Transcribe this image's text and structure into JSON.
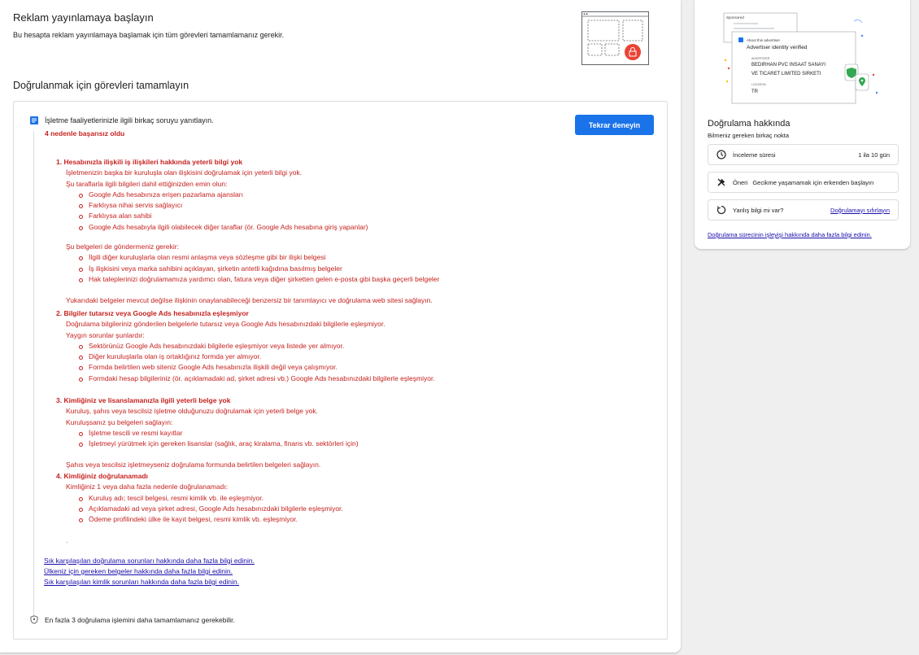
{
  "header": {
    "title": "Reklam yayınlamaya başlayın",
    "subtitle": "Bu hesapta reklam yayınlamaya başlamak için tüm görevleri tamamlamanız gerekir."
  },
  "tasks": {
    "section_title": "Doğrulanmak için görevleri tamamlayın",
    "question": "İşletme faaliyetlerinizle ilgili birkaç soruyu yanıtlayın.",
    "fail_text": "4 nedenle başarısız oldu",
    "retry_label": "Tekrar deneyin",
    "reasons": [
      {
        "title": "1. Hesabınızla ilişkili iş ilişkileri hakkında yeterli bilgi yok",
        "lines": [
          "İşletmenizin başka bir kuruluşla olan ilişkisini doğrulamak için yeterli bilgi yok.",
          "Şu taraflarla ilgili bilgileri dahil ettiğinizden emin olun:"
        ],
        "bullets": [
          "Google Ads hesabınıza erişen pazarlama ajansları",
          "Farklıysa nihai servis sağlayıcı",
          "Farklıysa alan sahibi",
          "Google Ads hesabıyla ilgili olabilecek diğer taraflar (ör. Google Ads hesabına giriş yapanlar)"
        ],
        "lines2": [
          "Şu belgeleri de göndermeniz gerekir:"
        ],
        "bullets2": [
          "İlgili diğer kuruluşlarla olan resmi anlaşma veya sözleşme gibi bir ilişki belgesi",
          "İş ilişkisini veya marka sahibini açıklayan, şirketin antetli kağıdına basılmış belgeler",
          "Hak taleplerinizi doğrulamamıza yardımcı olan, fatura veya diğer şirketten gelen e-posta gibi başka geçerli belgeler"
        ],
        "closing": "Yukarıdaki belgeler mevcut değilse ilişkinin onaylanabileceği benzersiz bir tanımlayıcı ve doğrulama web sitesi sağlayın."
      },
      {
        "title": "2. Bilgiler tutarsız veya Google Ads hesabınızla eşleşmiyor",
        "lines": [
          "Doğrulama bilgileriniz gönderilen belgelerle tutarsız veya Google Ads hesabınızdaki bilgilerle eşleşmiyor.",
          "Yaygın sorunlar şunlardır:"
        ],
        "bullets": [
          "Sektörünüz Google Ads hesabınızdaki bilgilerle eşleşmiyor veya listede yer almıyor.",
          "Diğer kuruluşlarla olan iş ortaklığınız formda yer almıyor.",
          "Formda belirtilen web siteniz Google Ads hesabınızla ilişkili değil veya çalışmıyor.",
          "Formdaki hesap bilgileriniz (ör. açıklamadaki ad, şirket adresi vb.) Google Ads hesabınızdaki bilgilerle eşleşmiyor."
        ]
      },
      {
        "title": "3. Kimliğiniz ve lisanslamanızla ilgili yeterli belge yok",
        "lines": [
          "Kuruluş, şahıs veya tescilsiz işletme olduğunuzu doğrulamak için yeterli belge yok.",
          "Kuruluşsanız şu belgeleri sağlayın:"
        ],
        "bullets": [
          "İşletme tescili ve resmi kayıtlar",
          "İşletmeyi yürütmek için gereken lisanslar (sağlık, araç kiralama, finans vb. sektörleri için)"
        ],
        "closing": "Şahıs veya tescilsiz işletmeyseniz doğrulama formunda belirtilen belgeleri sağlayın."
      },
      {
        "title": "4. Kimliğiniz doğrulanamadı",
        "lines": [
          "Kimliğiniz 1 veya daha fazla nedenle doğrulanamadı:"
        ],
        "bullets": [
          "Kuruluş adı; tescil belgesi, resmi kimlik vb. ile eşleşmiyor.",
          "Açıklamadaki ad veya şirket adresi, Google Ads hesabınızdaki bilgilerle eşleşmiyor.",
          "Ödeme profilindeki ülke ile kayıt belgesi, resmi kimlik vb. eşleşmiyor."
        ],
        "trailing": "."
      }
    ],
    "links": [
      "Sık karşılaşılan doğrulama sorunları hakkında daha fazla bilgi edinin.",
      "Ülkeniz için gereken belgeler hakkında daha fazla bilgi edinin.",
      "Sık karşılaşılan kimlik sorunları hakkında daha fazla bilgi edinin."
    ],
    "footer_note": "En fazla 3 doğrulama işlemini daha tamamlamanız gerekebilir."
  },
  "sidebar": {
    "illustration": {
      "sponsored": "Sponsored",
      "about": "About this advertiser",
      "verified": "Advertiser identity verified",
      "advertiser_label": "ADVERTISER",
      "advertiser_name_1": "BEDIRHAN PVC INSAAT SANAYI",
      "advertiser_name_2": "VE TICARET LIMITED SIRKETI",
      "location_label": "LOCATION",
      "location_value": "TR"
    },
    "title": "Doğrulama hakkında",
    "subtitle": "Bilmeniz gereken birkaç nokta",
    "review_label": "İnceleme süresi",
    "review_value": "1 ila 10 gün",
    "tip_label": "Öneri",
    "tip_value": "Gecikme yaşamamak için erkenden başlayın",
    "wrong_label": "Yanlış bilgi mi var?",
    "wrong_link": "Doğrulamayı sıfırlayın",
    "learn_link": "Doğrulama sürecinin işleyişi hakkında daha fazla bilgi edinin."
  },
  "colors": {
    "accent": "#1a73e8",
    "error": "#c5221f",
    "link": "#1a0dab"
  },
  "icons": [
    "document-icon",
    "shield-icon",
    "clock-icon",
    "tools-icon",
    "reset-icon",
    "lock-icon",
    "location-pin-icon"
  ]
}
